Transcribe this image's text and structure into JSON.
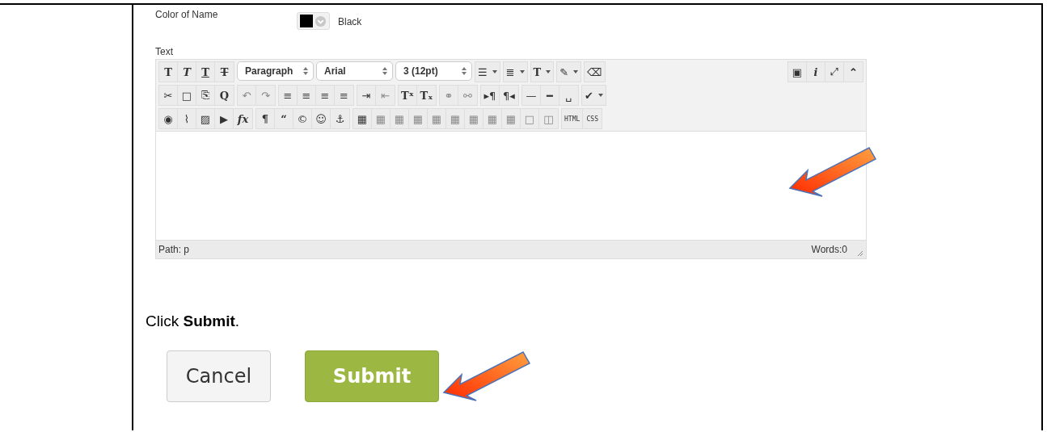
{
  "color_field": {
    "label": "Color of Name",
    "color": "#000000",
    "value": "Black"
  },
  "text_field": {
    "label": "Text"
  },
  "toolbar": {
    "lines": [
      {
        "groups": [
          {
            "buttons": [
              {
                "kind": "bold",
                "glyph": "T",
                "disabled": false
              },
              {
                "kind": "italic",
                "glyph": "T",
                "disabled": false
              },
              {
                "kind": "underline",
                "glyph": "T",
                "disabled": false
              },
              {
                "kind": "strike",
                "glyph": "T",
                "disabled": false
              }
            ]
          },
          {
            "buttons": [
              {
                "kind": "select",
                "value": "Paragraph"
              },
              {
                "kind": "select",
                "value": "Arial"
              },
              {
                "kind": "select",
                "value": "3 (12pt)"
              }
            ]
          },
          {
            "buttons": [
              {
                "kind": "plain",
                "glyph": "☰",
                "dropdown": true,
                "disabled": false
              }
            ]
          },
          {
            "buttons": [
              {
                "kind": "plain",
                "glyph": "≣",
                "dropdown": true,
                "disabled": false
              }
            ]
          },
          {
            "buttons": [
              {
                "kind": "serif",
                "glyph": "T",
                "dropdown": true,
                "disabled": false
              }
            ]
          },
          {
            "buttons": [
              {
                "kind": "plain",
                "glyph": "✎",
                "dropdown": true,
                "disabled": false
              }
            ]
          },
          {
            "buttons": [
              {
                "kind": "plain",
                "glyph": "⌫",
                "dropdown": false,
                "disabled": false
              }
            ]
          }
        ]
      },
      {
        "groups": [
          {
            "buttons": [
              {
                "kind": "plain",
                "glyph": "✂",
                "disabled": false
              },
              {
                "kind": "plain",
                "glyph": "□",
                "disabled": false
              },
              {
                "kind": "plain",
                "glyph": "⎘",
                "disabled": false
              },
              {
                "kind": "bold",
                "glyph": "Q",
                "disabled": false
              }
            ]
          },
          {
            "buttons": [
              {
                "kind": "plain",
                "glyph": "↶",
                "disabled": true
              },
              {
                "kind": "plain",
                "glyph": "↷",
                "disabled": true
              }
            ]
          },
          {
            "buttons": [
              {
                "kind": "plain",
                "glyph": "≡",
                "disabled": false
              },
              {
                "kind": "plain",
                "glyph": "≡",
                "disabled": false
              },
              {
                "kind": "plain",
                "glyph": "≡",
                "disabled": false
              },
              {
                "kind": "plain",
                "glyph": "≡",
                "disabled": false
              }
            ]
          },
          {
            "buttons": [
              {
                "kind": "plain",
                "glyph": "⇥",
                "disabled": false
              },
              {
                "kind": "plain",
                "glyph": "⇤",
                "disabled": true
              }
            ]
          },
          {
            "buttons": [
              {
                "kind": "serif",
                "glyph": "Tˣ",
                "disabled": false
              },
              {
                "kind": "serif",
                "glyph": "Tₓ",
                "disabled": false
              }
            ]
          },
          {
            "buttons": [
              {
                "kind": "plain",
                "glyph": "⚭",
                "disabled": true
              },
              {
                "kind": "plain",
                "glyph": "⚯",
                "disabled": true
              }
            ]
          },
          {
            "buttons": [
              {
                "kind": "plain",
                "glyph": "▸¶",
                "disabled": false
              },
              {
                "kind": "plain",
                "glyph": "¶◂",
                "disabled": false
              }
            ]
          },
          {
            "buttons": [
              {
                "kind": "plain",
                "glyph": "—",
                "disabled": false
              },
              {
                "kind": "plain",
                "glyph": "━",
                "disabled": false
              },
              {
                "kind": "plain",
                "glyph": "␣",
                "disabled": false
              }
            ]
          },
          {
            "buttons": [
              {
                "kind": "plain",
                "glyph": "✔",
                "dropdown": true,
                "disabled": false
              }
            ]
          }
        ]
      },
      {
        "groups": [
          {
            "buttons": [
              {
                "kind": "plain",
                "glyph": "◉",
                "disabled": false
              },
              {
                "kind": "plain",
                "glyph": "⌇",
                "disabled": false
              },
              {
                "kind": "plain",
                "glyph": "▨",
                "disabled": false
              },
              {
                "kind": "plain",
                "glyph": "▶",
                "disabled": false
              },
              {
                "kind": "italic",
                "glyph": "fx",
                "disabled": false
              }
            ]
          },
          {
            "buttons": [
              {
                "kind": "bold",
                "glyph": "¶",
                "disabled": false
              },
              {
                "kind": "bold",
                "glyph": "“",
                "disabled": false
              },
              {
                "kind": "plain",
                "glyph": "©",
                "disabled": false
              },
              {
                "kind": "plain",
                "glyph": "☺",
                "disabled": false
              },
              {
                "kind": "plain",
                "glyph": "⚓",
                "disabled": false
              }
            ]
          },
          {
            "buttons": [
              {
                "kind": "plain",
                "glyph": "▦",
                "disabled": false
              },
              {
                "kind": "plain",
                "glyph": "▦",
                "disabled": true
              },
              {
                "kind": "plain",
                "glyph": "▦",
                "disabled": true
              },
              {
                "kind": "plain",
                "glyph": "▦",
                "disabled": true
              },
              {
                "kind": "plain",
                "glyph": "▦",
                "disabled": true
              },
              {
                "kind": "plain",
                "glyph": "▦",
                "disabled": true
              },
              {
                "kind": "plain",
                "glyph": "▦",
                "disabled": true
              },
              {
                "kind": "plain",
                "glyph": "▦",
                "disabled": true
              },
              {
                "kind": "plain",
                "glyph": "▦",
                "disabled": true
              },
              {
                "kind": "plain",
                "glyph": "□",
                "disabled": true
              },
              {
                "kind": "plain",
                "glyph": "◫",
                "disabled": true
              }
            ]
          },
          {
            "buttons": [
              {
                "kind": "tiny",
                "glyph": "HTML",
                "disabled": false
              },
              {
                "kind": "tiny",
                "glyph": "CSS",
                "disabled": false
              }
            ]
          }
        ]
      }
    ],
    "right_group": [
      {
        "kind": "plain",
        "glyph": "▣",
        "disabled": false
      },
      {
        "kind": "italic",
        "glyph": "i",
        "disabled": false
      },
      {
        "kind": "plain",
        "glyph": "⤢",
        "disabled": false
      },
      {
        "kind": "bold",
        "glyph": "⌃",
        "disabled": false
      }
    ]
  },
  "status_bar": {
    "path_label": "Path:",
    "path": "p",
    "words": "Words:0"
  },
  "instruction": "Click **Submit**.",
  "buttons": [
    {
      "label": "Cancel",
      "kind": "secondary"
    },
    {
      "label": "Submit",
      "kind": "primary"
    }
  ]
}
